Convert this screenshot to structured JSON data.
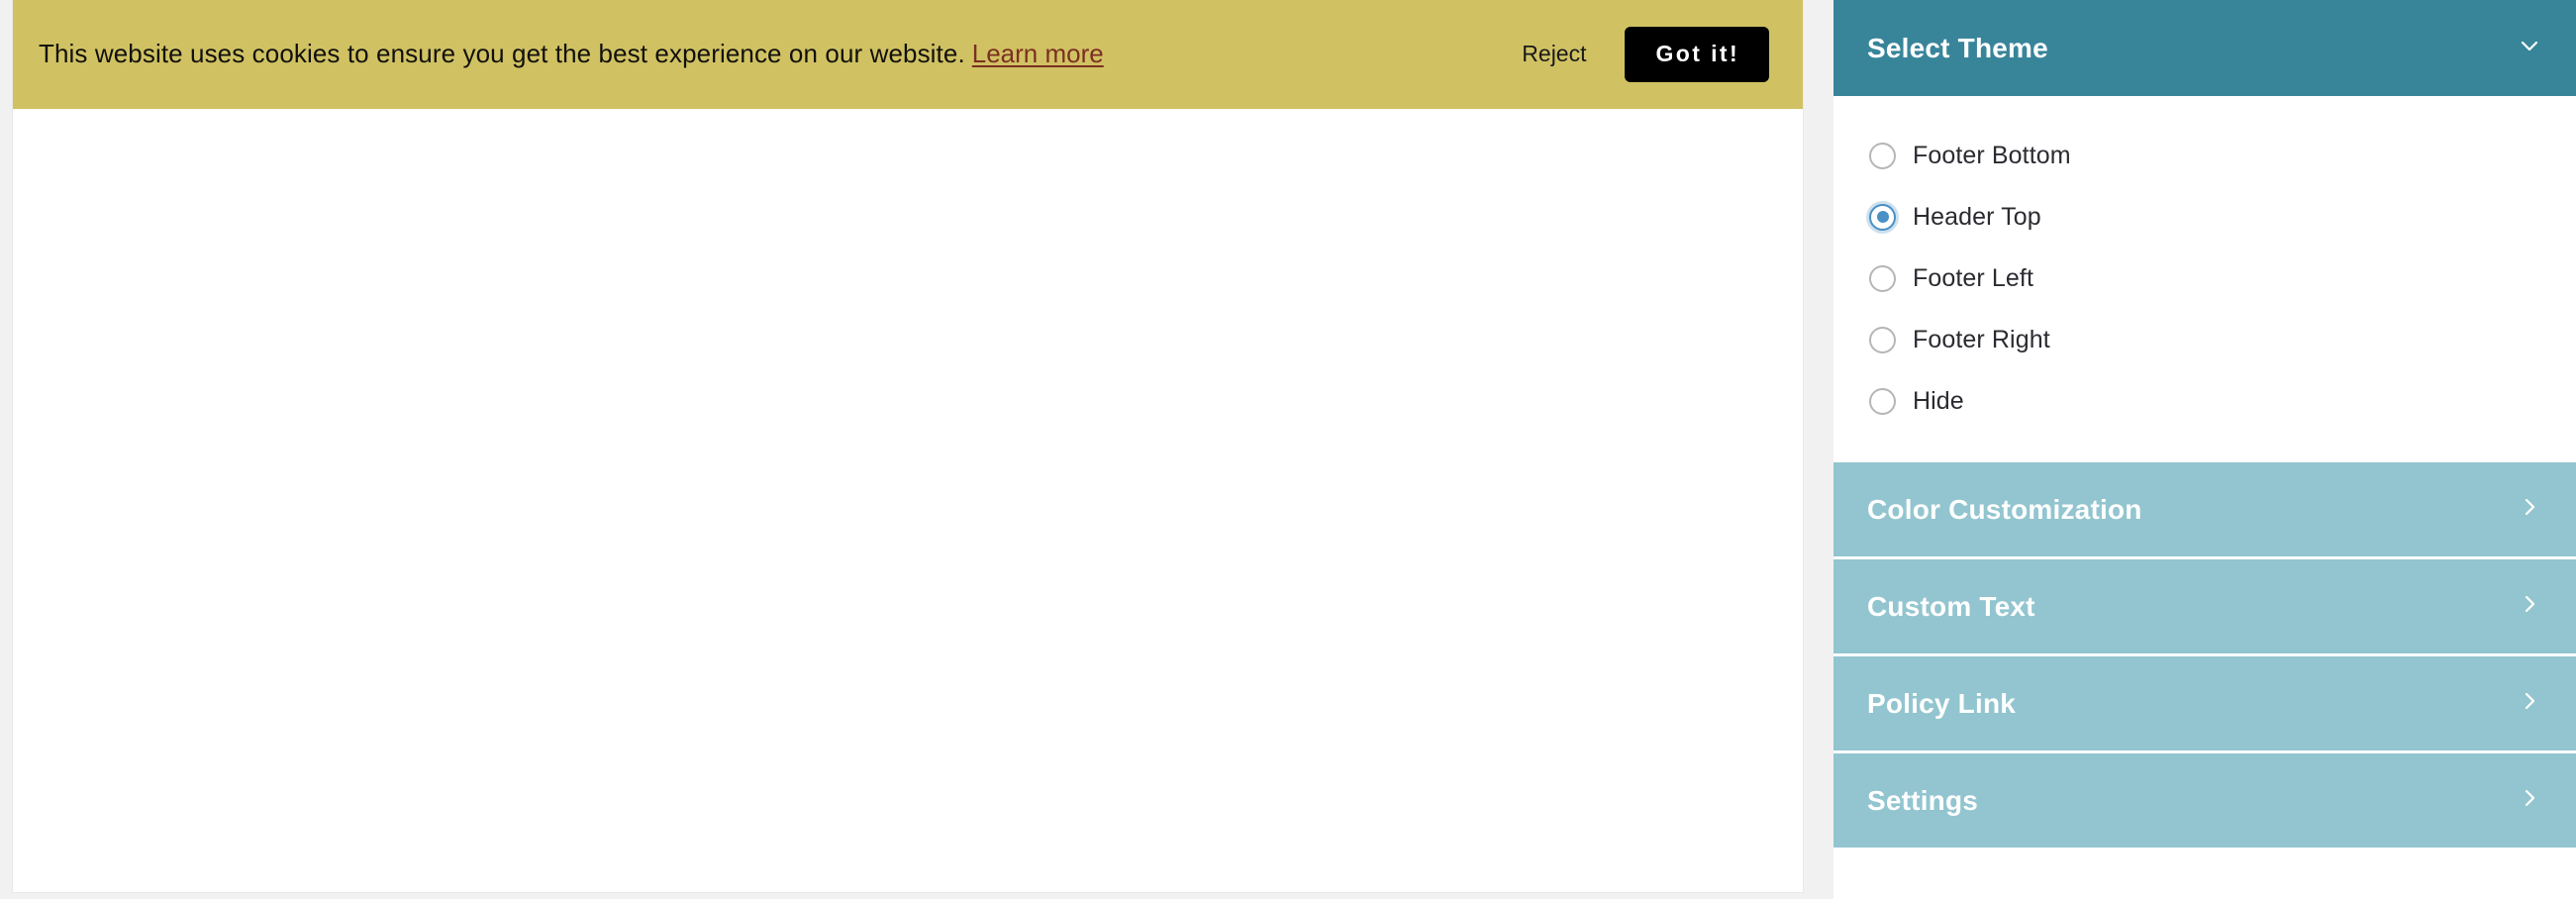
{
  "cookie_banner": {
    "message": "This website uses cookies to ensure you get the best experience on our website.",
    "learn_more_label": "Learn more",
    "reject_label": "Reject",
    "accept_label": "Got it!",
    "background_color": "#d0c263",
    "accept_button_color": "#000000",
    "link_color": "#7b2f22"
  },
  "panel": {
    "header": {
      "title": "Select Theme",
      "chevron": "chevron-down-icon",
      "background_color": "#38859a"
    },
    "theme_options": [
      {
        "label": "Footer Bottom",
        "selected": false
      },
      {
        "label": "Header Top",
        "selected": true
      },
      {
        "label": "Footer Left",
        "selected": false
      },
      {
        "label": "Footer Right",
        "selected": false
      },
      {
        "label": "Hide",
        "selected": false
      }
    ],
    "selected_theme": "Header Top",
    "sections": [
      {
        "label": "Color Customization",
        "chevron": "chevron-right-icon"
      },
      {
        "label": "Custom Text",
        "chevron": "chevron-right-icon"
      },
      {
        "label": "Policy Link",
        "chevron": "chevron-right-icon"
      },
      {
        "label": "Settings",
        "chevron": "chevron-right-icon"
      }
    ],
    "section_background_color": "#92c5cf",
    "radio_accent_color": "#4a90c4"
  }
}
